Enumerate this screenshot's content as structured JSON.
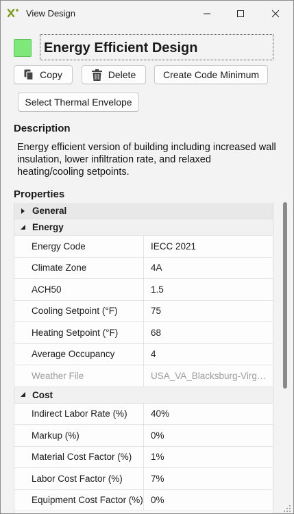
{
  "window": {
    "title": "View Design"
  },
  "design": {
    "name": "Energy Efficient Design",
    "color": "#7ee87a"
  },
  "toolbar": {
    "copy_label": "Copy",
    "delete_label": "Delete",
    "code_minimum_label": "Create Code Minimum",
    "thermal_envelope_label": "Select Thermal Envelope"
  },
  "description": {
    "heading": "Description",
    "text": "Energy efficient version of building including increased wall insulation, lower infiltration rate, and relaxed heating/cooling setpoints."
  },
  "properties": {
    "heading": "Properties",
    "categories": [
      {
        "label": "General",
        "expanded": false
      },
      {
        "label": "Energy",
        "expanded": true,
        "rows": [
          {
            "name": "Energy Code",
            "value": "IECC 2021"
          },
          {
            "name": "Climate Zone",
            "value": "4A"
          },
          {
            "name": "ACH50",
            "value": "1.5"
          },
          {
            "name": "Cooling Setpoint (°F)",
            "value": "75"
          },
          {
            "name": "Heating Setpoint (°F)",
            "value": "68"
          },
          {
            "name": "Average Occupancy",
            "value": "4"
          },
          {
            "name": "Weather File",
            "value": "USA_VA_Blacksburg-Virgini..."
          }
        ]
      },
      {
        "label": "Cost",
        "expanded": true,
        "rows": [
          {
            "name": "Indirect Labor Rate (%)",
            "value": "40%"
          },
          {
            "name": "Markup (%)",
            "value": "0%"
          },
          {
            "name": "Material Cost Factor (%)",
            "value": "1%"
          },
          {
            "name": "Labor Cost Factor (%)",
            "value": "7%"
          },
          {
            "name": "Equipment Cost Factor (%)",
            "value": "0%"
          }
        ]
      }
    ]
  }
}
